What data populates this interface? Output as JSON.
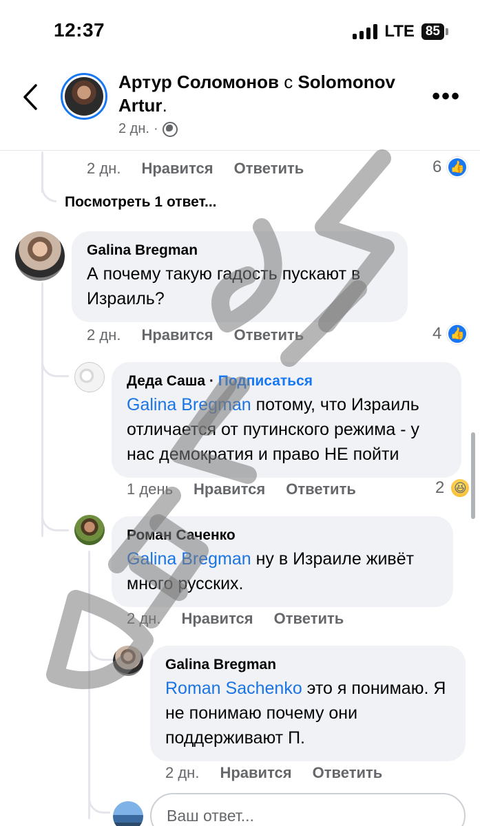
{
  "status_bar": {
    "time": "12:37",
    "network": "LTE",
    "battery": "85"
  },
  "header": {
    "author": "Артур Соломонов",
    "with_word": "с",
    "tagged": "Solomonov Artur",
    "period": ".",
    "meta_time": "2 дн.",
    "meta_dot": "·"
  },
  "labels": {
    "like": "Нравится",
    "reply": "Ответить",
    "follow": "Подписаться",
    "name_dot": "·"
  },
  "top_comment_actions": {
    "time": "2 дн.",
    "reactions": "6"
  },
  "view_replies": "Посмотреть 1 ответ...",
  "comments": [
    {
      "author": "Galina Bregman",
      "text": "А почему такую гадость пускают в Израиль?",
      "time": "2 дн.",
      "reactions": "4"
    },
    {
      "author": "Деда Саша",
      "mention": "Galina Bregman",
      "text": " потому, что Израиль отличается от путинского режима - у нас демократия и право НЕ пойти",
      "time": "1 день",
      "reactions": "2"
    },
    {
      "author": "Роман Саченко",
      "mention": "Galina Bregman",
      "text": " ну в Израиле живёт много русских.",
      "time": "2 дн."
    },
    {
      "author": "Galina Bregman",
      "mention": "Roman Sachenko",
      "text": " это я понимаю. Я не понимаю почему они поддерживают П.",
      "time": "2 дн."
    }
  ],
  "reply_input": {
    "placeholder": "Ваш ответ..."
  },
  "icons": {
    "back": "chevron-left-icon",
    "more": "more-dots-icon",
    "privacy": "globe-icon",
    "like": "like-thumb-icon",
    "haha": "haha-emoji-icon"
  },
  "colors": {
    "accent": "#1877f2",
    "bubble": "#f0f2f5",
    "secondary_text": "#65676b"
  }
}
